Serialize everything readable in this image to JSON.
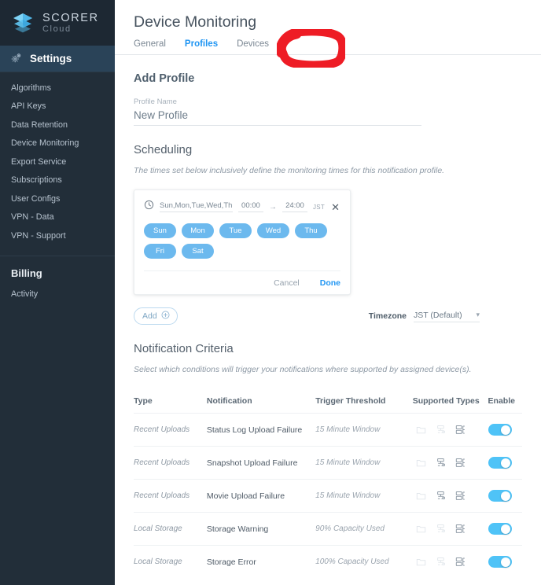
{
  "brand": {
    "name": "SCORER",
    "sub": "Cloud",
    "logo_icon": "layers-cube-icon",
    "accent": "#5bc8f5"
  },
  "sidebar": {
    "active_section": {
      "label": "Settings",
      "icon": "gears-icon"
    },
    "items": [
      {
        "label": "Algorithms"
      },
      {
        "label": "API Keys"
      },
      {
        "label": "Data Retention"
      },
      {
        "label": "Device Monitoring"
      },
      {
        "label": "Export Service"
      },
      {
        "label": "Subscriptions"
      },
      {
        "label": "User Configs"
      },
      {
        "label": "VPN - Data"
      },
      {
        "label": "VPN - Support"
      }
    ],
    "billing": {
      "heading": "Billing",
      "items": [
        {
          "label": "Activity"
        }
      ]
    },
    "bg": "#222e39",
    "active_bg": "#2a4358"
  },
  "header": {
    "title": "Device Monitoring"
  },
  "tabs": [
    {
      "label": "General",
      "active": false
    },
    {
      "label": "Profiles",
      "active": true
    },
    {
      "label": "Devices",
      "active": false
    }
  ],
  "annotation": {
    "shape": "hand-drawn-circle",
    "color": "#ee1c25",
    "target": "Profiles"
  },
  "add_profile": {
    "title": "Add Profile",
    "name_label": "Profile Name",
    "name_value": "New Profile",
    "name_placeholder": "Profile Name"
  },
  "scheduling": {
    "title": "Scheduling",
    "description": "The times set below inclusively define the monitoring times for this notification profile.",
    "card": {
      "clock_icon": "clock-icon",
      "days_summary": "Sun,Mon,Tue,Wed,Thu,Fr",
      "start_time": "00:00",
      "arrow": "→",
      "end_time": "24:00",
      "timezone_abbr": "JST",
      "close_icon": "close-icon",
      "day_chips": [
        {
          "label": "Sun",
          "selected": true
        },
        {
          "label": "Mon",
          "selected": true
        },
        {
          "label": "Tue",
          "selected": true
        },
        {
          "label": "Wed",
          "selected": true
        },
        {
          "label": "Thu",
          "selected": true
        },
        {
          "label": "Fri",
          "selected": true
        },
        {
          "label": "Sat",
          "selected": true
        }
      ],
      "chip_color": "#6cb9ee",
      "cancel_label": "Cancel",
      "done_label": "Done",
      "done_color": "#2196f3"
    },
    "add_button": {
      "label": "Add",
      "icon": "plus-circle-icon"
    },
    "timezone": {
      "label": "Timezone",
      "value": "JST (Default)",
      "caret_icon": "chevron-down-icon"
    }
  },
  "notification_criteria": {
    "title": "Notification Criteria",
    "description": "Select which conditions will trigger your notifications where supported by assigned device(s).",
    "columns": [
      "Type",
      "Notification",
      "Trigger Threshold",
      "Supported Types",
      "Enable"
    ],
    "type_icons": [
      "folder-icon",
      "network-device-icon",
      "server-rack-icon"
    ],
    "toggle_color": "#4fc3f7",
    "rows": [
      {
        "type": "Recent Uploads",
        "notification": "Status Log Upload Failure",
        "threshold": "15 Minute Window",
        "supported": [
          false,
          false,
          true
        ],
        "enabled": true
      },
      {
        "type": "Recent Uploads",
        "notification": "Snapshot Upload Failure",
        "threshold": "15 Minute Window",
        "supported": [
          false,
          true,
          true
        ],
        "enabled": true
      },
      {
        "type": "Recent Uploads",
        "notification": "Movie Upload Failure",
        "threshold": "15 Minute Window",
        "supported": [
          false,
          true,
          true
        ],
        "enabled": true
      },
      {
        "type": "Local Storage",
        "notification": "Storage Warning",
        "threshold": "90% Capacity Used",
        "supported": [
          false,
          false,
          true
        ],
        "enabled": true
      },
      {
        "type": "Local Storage",
        "notification": "Storage Error",
        "threshold": "100% Capacity Used",
        "supported": [
          false,
          false,
          true
        ],
        "enabled": true
      }
    ]
  }
}
